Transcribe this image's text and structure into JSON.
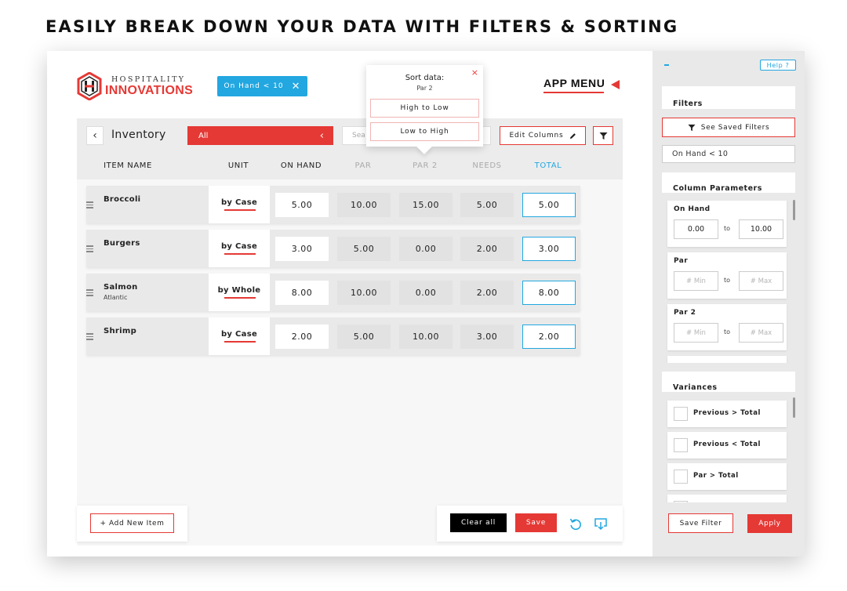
{
  "headline": "EASILY BREAK DOWN YOUR DATA WITH FILTERS & SORTING",
  "brand": {
    "line1": "HOSPITALITY",
    "line2": "INNOVATIONS"
  },
  "active_filter_chip": {
    "label": "On Hand < 10"
  },
  "app_menu": "APP MENU",
  "toolbar": {
    "title": "Inventory",
    "category": "All",
    "search_placeholder": "Sea",
    "edit_columns": "Edit Columns"
  },
  "columns": [
    "ITEM NAME",
    "UNIT",
    "ON HAND",
    "PAR",
    "PAR 2",
    "NEEDS",
    "TOTAL"
  ],
  "rows": [
    {
      "name": "Broccoli",
      "sub": "",
      "unit": "by Case",
      "on_hand": "5.00",
      "par": "10.00",
      "par2": "15.00",
      "needs": "5.00",
      "total": "5.00"
    },
    {
      "name": "Burgers",
      "sub": "",
      "unit": "by Case",
      "on_hand": "3.00",
      "par": "5.00",
      "par2": "0.00",
      "needs": "2.00",
      "total": "3.00"
    },
    {
      "name": "Salmon",
      "sub": "Atlantic",
      "unit": "by Whole",
      "on_hand": "8.00",
      "par": "10.00",
      "par2": "0.00",
      "needs": "2.00",
      "total": "8.00"
    },
    {
      "name": "Shrimp",
      "sub": "",
      "unit": "by Case",
      "on_hand": "2.00",
      "par": "5.00",
      "par2": "10.00",
      "needs": "3.00",
      "total": "2.00"
    }
  ],
  "sort_popover": {
    "title": "Sort data:",
    "subtitle": "Par 2",
    "close": "×",
    "options": [
      "High to Low",
      "Low to High"
    ]
  },
  "footer": {
    "add_item": "+ Add New Item",
    "clear_all": "Clear all",
    "save": "Save"
  },
  "sidebar": {
    "help": "Help ?",
    "filters_title": "Filters",
    "saved_filters": "See Saved Filters",
    "filter_text": "On Hand < 10",
    "column_params_title": "Column Parameters",
    "params": [
      {
        "name": "On Hand",
        "min": "0.00",
        "max": "10.00",
        "to": "to"
      },
      {
        "name": "Par",
        "min_placeholder": "# Min",
        "max_placeholder": "# Max",
        "to": "to"
      },
      {
        "name": "Par 2",
        "min_placeholder": "# Min",
        "max_placeholder": "# Max",
        "to": "to"
      }
    ],
    "variances_title": "Variances",
    "variances": [
      "Previous > Total",
      "Previous < Total",
      "Par > Total"
    ],
    "save_filter": "Save Filter",
    "apply": "Apply"
  },
  "colors": {
    "accent_red": "#e53935",
    "accent_blue": "#22a7e0"
  }
}
